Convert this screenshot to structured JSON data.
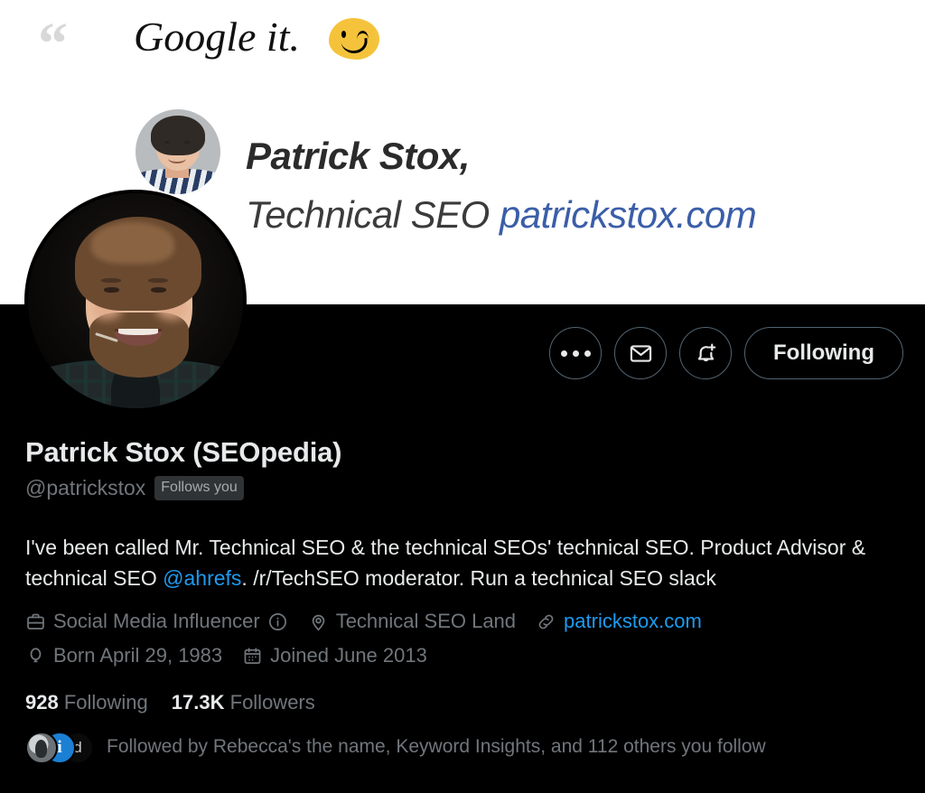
{
  "banner": {
    "quote_mark": "“",
    "quote_text": "Google it.",
    "emoji_name": "winking-face-emoji",
    "name": "Patrick Stox,",
    "subtitle_role": "Technical SEO",
    "subtitle_site": "patrickstox.com"
  },
  "actions": {
    "more_label": "More",
    "message_label": "Message",
    "notify_label": "Notify",
    "following_label": "Following"
  },
  "profile": {
    "display_name": "Patrick Stox (SEOpedia)",
    "handle": "@patrickstox",
    "follows_you_badge": "Follows you",
    "bio_part1": "I've been called Mr. Technical SEO & the technical SEOs' technical SEO. Product Advisor & technical SEO ",
    "bio_mention": "@ahrefs",
    "bio_part2": ". /r/TechSEO moderator. Run a technical SEO slack"
  },
  "meta": {
    "professional_category": "Social Media Influencer",
    "info_icon_label": "About professional category",
    "location": "Technical SEO Land",
    "website": "patrickstox.com",
    "birthday": "Born April 29, 1983",
    "joined": "Joined June 2013"
  },
  "stats": {
    "following_count": "928",
    "following_label": "Following",
    "followers_count": "17.3K",
    "followers_label": "Followers"
  },
  "social_proof": {
    "text": "Followed by Rebecca's the name, Keyword Insights, and 112 others you follow",
    "avatar2_initial": "i",
    "avatar3_initial": "d"
  },
  "colors": {
    "background": "#000000",
    "text_primary": "#e7e9ea",
    "text_secondary": "#71767b",
    "link_blue": "#1d9bf0",
    "border": "#536471",
    "badge_bg": "#2f3336",
    "banner_bg": "#ffffff",
    "banner_link": "#3b5ea8"
  }
}
